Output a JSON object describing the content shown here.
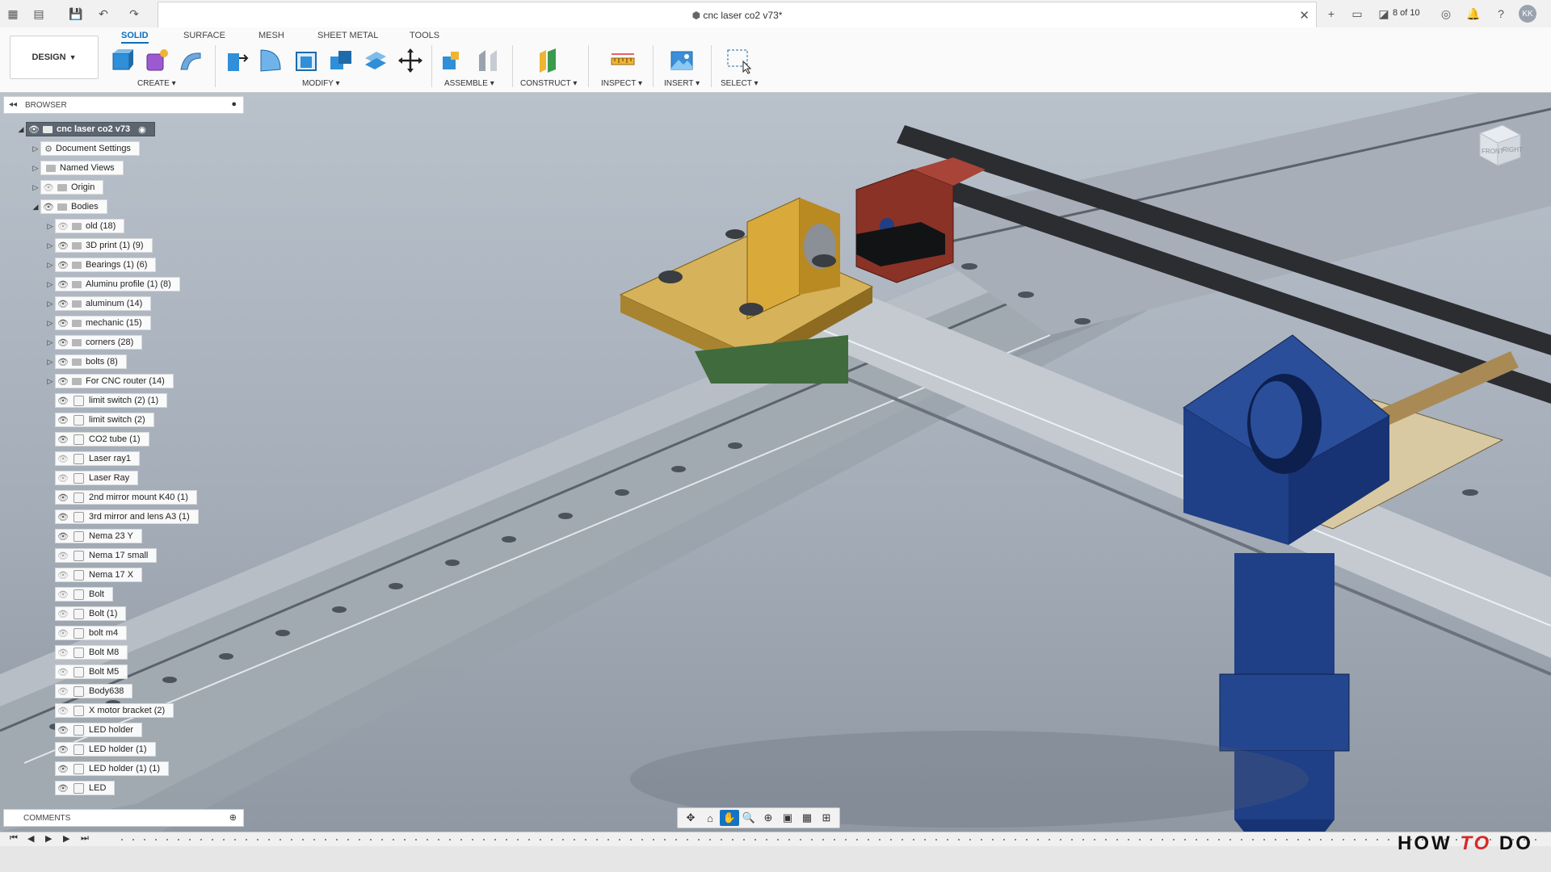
{
  "titlebar": {
    "doc_title": "cnc laser co2 v73*",
    "page_counter": "8 of 10",
    "user_initials": "KK"
  },
  "toolbar": {
    "workspace": "DESIGN",
    "tabs": [
      "SOLID",
      "SURFACE",
      "MESH",
      "SHEET METAL",
      "TOOLS"
    ],
    "groups": [
      "CREATE",
      "MODIFY",
      "ASSEMBLE",
      "CONSTRUCT",
      "INSPECT",
      "INSERT",
      "SELECT"
    ]
  },
  "browser": {
    "title": "BROWSER",
    "root": "cnc laser co2 v73",
    "folders": [
      "Document Settings",
      "Named Views",
      "Origin",
      "Bodies"
    ],
    "body_folders": [
      "old (18)",
      "3D print (1) (9)",
      "Bearings (1) (6)",
      "Aluminu profile (1) (8)",
      "aluminum (14)",
      "mechanic (15)",
      "corners (28)",
      "bolts (8)",
      "For CNC router (14)"
    ],
    "bodies": [
      "limit switch (2) (1)",
      "limit switch (2)",
      "CO2 tube (1)",
      "Laser ray1",
      "Laser Ray",
      "2nd mirror mount K40 (1)",
      "3rd mirror and lens A3 (1)",
      "Nema 23 Y",
      "Nema 17 small",
      "Nema 17 X",
      "Bolt",
      "Bolt (1)",
      "bolt m4",
      "Bolt M8",
      "Bolt M5",
      "Body638",
      "X motor bracket (2)",
      "LED holder",
      "LED holder (1)",
      "LED holder (1) (1)",
      "LED"
    ]
  },
  "comments": {
    "title": "COMMENTS"
  },
  "viewcube": {
    "front": "FRONT",
    "right": "RIGHT"
  },
  "watermark": {
    "how": "HOW",
    "to": "TO",
    "do": "DO"
  },
  "colors": {
    "accent": "#0b6fbf",
    "holder_blue": "#1f3f86",
    "bracket_yellow": "#d9a93a",
    "motor_red": "#8a3226",
    "rail_gray": "#aab0b8"
  }
}
